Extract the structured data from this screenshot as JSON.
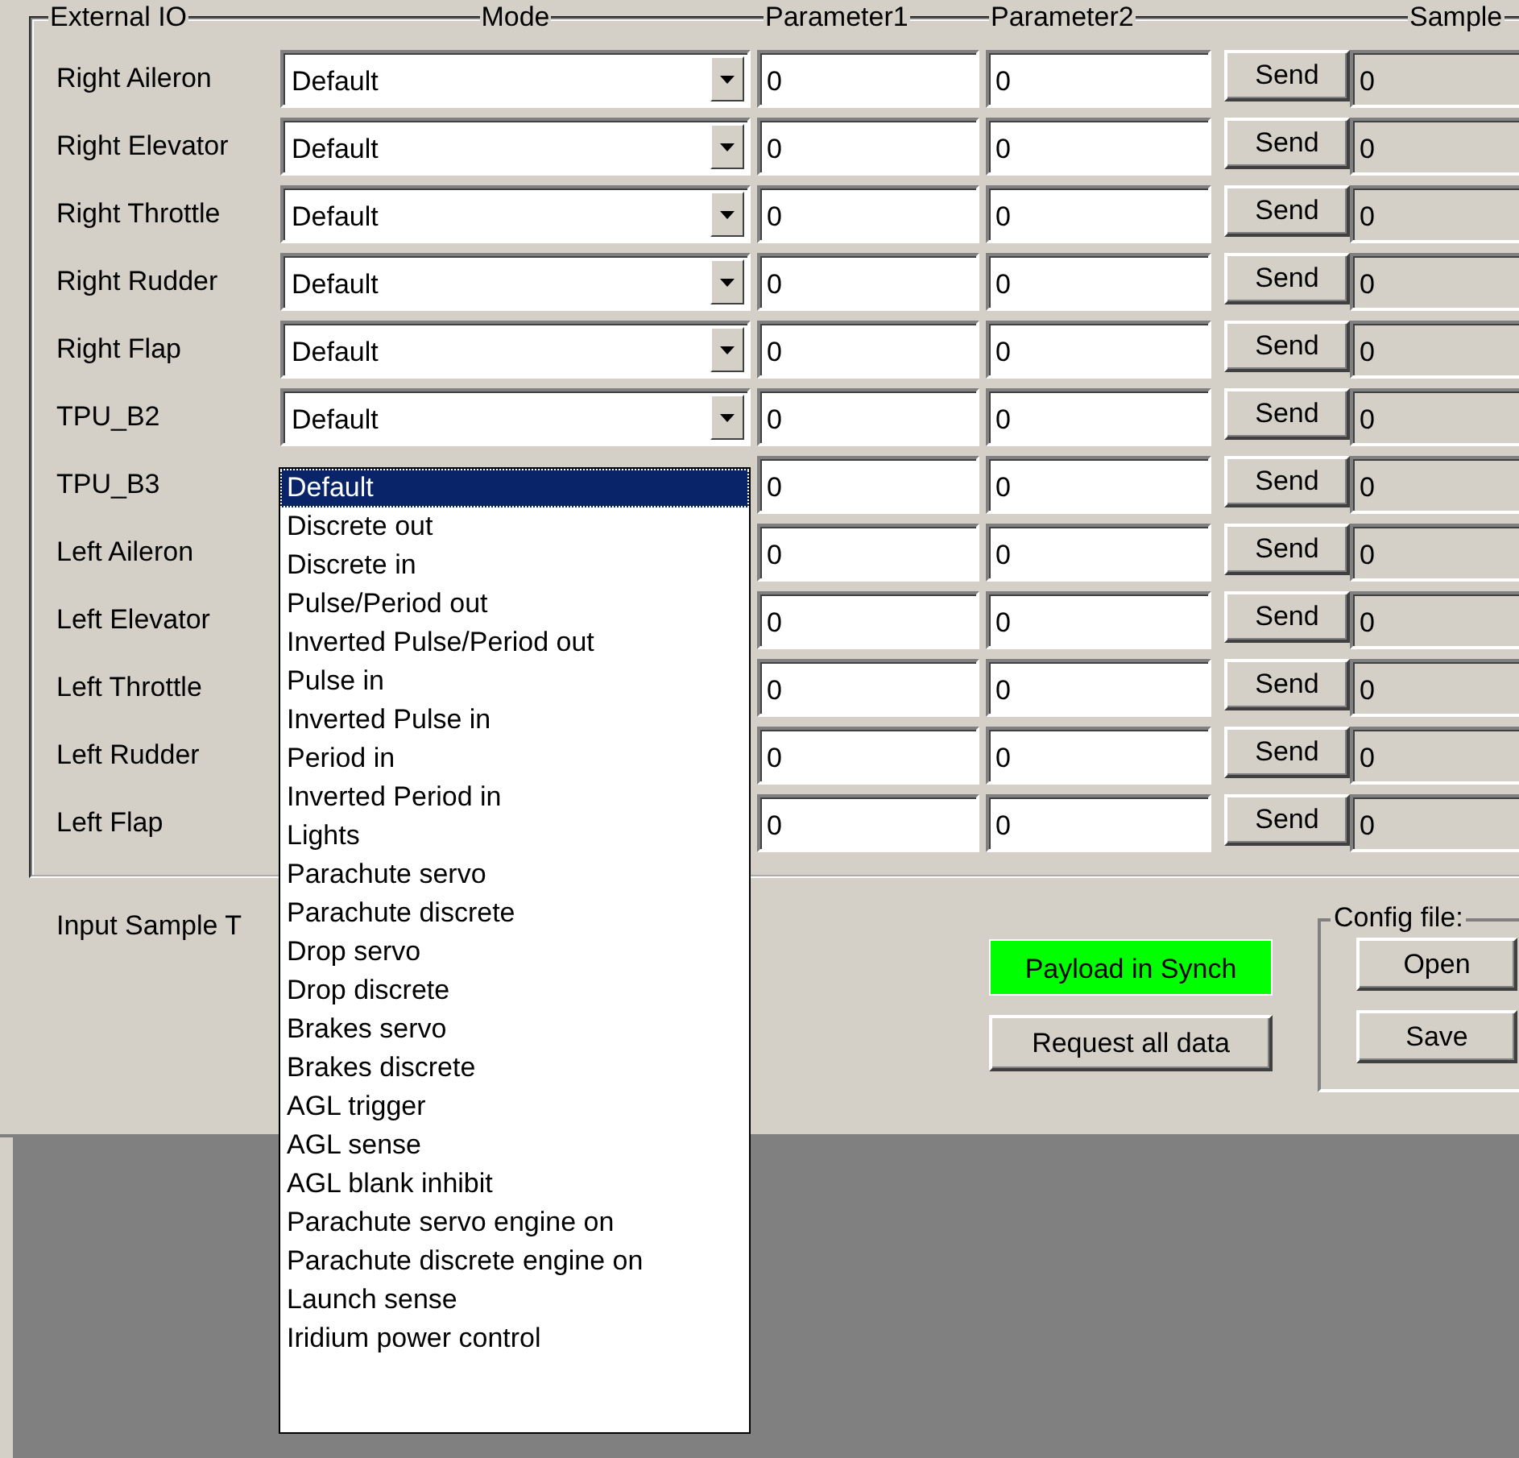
{
  "group": {
    "title": "External IO",
    "columns": [
      "Mode",
      "Parameter1",
      "Parameter2",
      "Sample"
    ]
  },
  "rows": [
    {
      "label": "Right Aileron",
      "mode": "Default",
      "parameter1": "0",
      "parameter2": "0",
      "button": "Send",
      "sample": "0"
    },
    {
      "label": "Right Elevator",
      "mode": "Default",
      "parameter1": "0",
      "parameter2": "0",
      "button": "Send",
      "sample": "0"
    },
    {
      "label": "Right Throttle",
      "mode": "Default",
      "parameter1": "0",
      "parameter2": "0",
      "button": "Send",
      "sample": "0"
    },
    {
      "label": "Right Rudder",
      "mode": "Default",
      "parameter1": "0",
      "parameter2": "0",
      "button": "Send",
      "sample": "0"
    },
    {
      "label": "Right Flap",
      "mode": "Default",
      "parameter1": "0",
      "parameter2": "0",
      "button": "Send",
      "sample": "0"
    },
    {
      "label": "TPU_B2",
      "mode": "Default",
      "parameter1": "0",
      "parameter2": "0",
      "button": "Send",
      "sample": "0"
    },
    {
      "label": "TPU_B3",
      "parameter1": "0",
      "parameter2": "0",
      "button": "Send",
      "sample": "0"
    },
    {
      "label": "Left Aileron",
      "parameter1": "0",
      "parameter2": "0",
      "button": "Send",
      "sample": "0"
    },
    {
      "label": "Left Elevator",
      "parameter1": "0",
      "parameter2": "0",
      "button": "Send",
      "sample": "0"
    },
    {
      "label": "Left Throttle",
      "parameter1": "0",
      "parameter2": "0",
      "button": "Send",
      "sample": "0"
    },
    {
      "label": "Left Rudder",
      "parameter1": "0",
      "parameter2": "0",
      "button": "Send",
      "sample": "0"
    },
    {
      "label": "Left Flap",
      "parameter1": "0",
      "parameter2": "0",
      "button": "Send",
      "sample": "0"
    }
  ],
  "dropdown": {
    "items": [
      {
        "label": "Default",
        "selected": true
      },
      {
        "label": "Discrete out",
        "selected": false
      },
      {
        "label": "Discrete in",
        "selected": false
      },
      {
        "label": "Pulse/Period out",
        "selected": false
      },
      {
        "label": "Inverted Pulse/Period out",
        "selected": false
      },
      {
        "label": "Pulse in",
        "selected": false
      },
      {
        "label": "Inverted Pulse in",
        "selected": false
      },
      {
        "label": "Period in",
        "selected": false
      },
      {
        "label": "Inverted Period in",
        "selected": false
      },
      {
        "label": "Lights",
        "selected": false
      },
      {
        "label": "Parachute servo",
        "selected": false
      },
      {
        "label": "Parachute discrete",
        "selected": false
      },
      {
        "label": "Drop servo",
        "selected": false
      },
      {
        "label": "Drop discrete",
        "selected": false
      },
      {
        "label": "Brakes servo",
        "selected": false
      },
      {
        "label": "Brakes discrete",
        "selected": false
      },
      {
        "label": "AGL trigger",
        "selected": false
      },
      {
        "label": "AGL sense",
        "selected": false
      },
      {
        "label": "AGL blank inhibit",
        "selected": false
      },
      {
        "label": "Parachute servo engine on",
        "selected": false
      },
      {
        "label": "Parachute discrete engine on",
        "selected": false
      },
      {
        "label": "Launch sense",
        "selected": false
      },
      {
        "label": "Iridium power control",
        "selected": false
      }
    ]
  },
  "input_sample_label": "Input Sample T",
  "status": {
    "label": "Payload in Synch",
    "synched": true
  },
  "request_button": "Request all data",
  "config": {
    "title": "Config file:",
    "buttons": [
      "Open",
      "Save"
    ]
  }
}
